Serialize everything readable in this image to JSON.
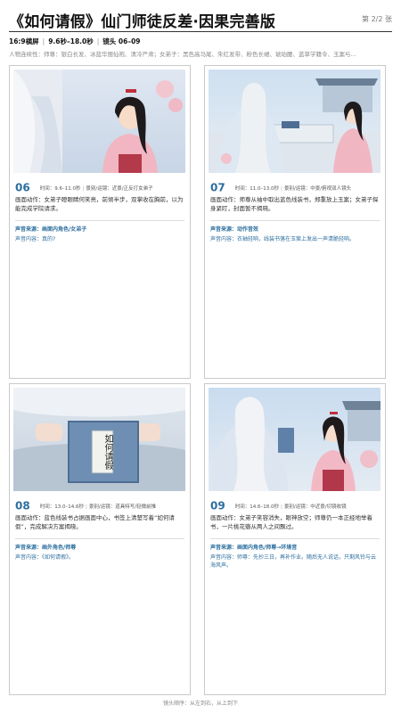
{
  "title": "《如何请假》仙门师徒反差·因果完善版",
  "page_indicator": "第 2/2 张",
  "meta": {
    "ratio": "16:9横屏",
    "time_range": "9.6秒–18.0秒",
    "shot_range": "镜头 06–09"
  },
  "characters": "人物连续性：师尊：银白长发、冰蓝华丽仙袍、清冷严肃；女弟子：黑色高马尾、朱红发带、粉色长裙、琥珀腰、蓝草学籍令、玉案与...",
  "cards": [
    {
      "no": "06",
      "time": "时间：9.6–11.0秒",
      "shot": "景别/运镜：近景/正反打女弟子",
      "action": "画面动作：女弟子瞪眼睛何笑亮，前倾半步，双掌收在胸前，以为能完成学院请求。",
      "source": "声音来源：画面内角色/女弟子",
      "content": "声音内容：真的?"
    },
    {
      "no": "07",
      "time": "时间：11.0–13.0秒",
      "shot": "景别/运镜：中景/俯视双人镜头",
      "action": "画面动作：师尊从袖中取出蓝色线装书，郑重放上玉案；女弟子探身紧盯，封面暂不揭晓。",
      "source": "声音来源：动作音效",
      "content": "声音内容：衣袖轻响，线装书落在玉案上发出一声清脆轻响。"
    },
    {
      "no": "08",
      "time": "时间：13.0–14.6秒",
      "shot": "景别/运镜：道具特写/轻微前推",
      "action": "画面动作：蓝色线装书占据画面中心，书签上清楚写着“如何请假”，完成解决方案揭晓。",
      "source": "声音来源：画外角色/师尊",
      "content": "声音内容：《如何请假》。",
      "book_title": "如何请假"
    },
    {
      "no": "09",
      "time": "时间：14.6–18.0秒",
      "shot": "景别/运镜：中近景/切镜收镜",
      "action": "画面动作：女弟子笑容消失，眼神放空；师尊仍一本正经地举着书，一片桃花瓣从两人之间飘过。",
      "source": "声音来源：画面内角色/师尊→环境音",
      "content": "声音内容：师尊：先抄三日，再补作业。随后无人说话，只剩风铃与云海风声。"
    }
  ],
  "footer": "镜头顺序：从左到右，从上到下"
}
